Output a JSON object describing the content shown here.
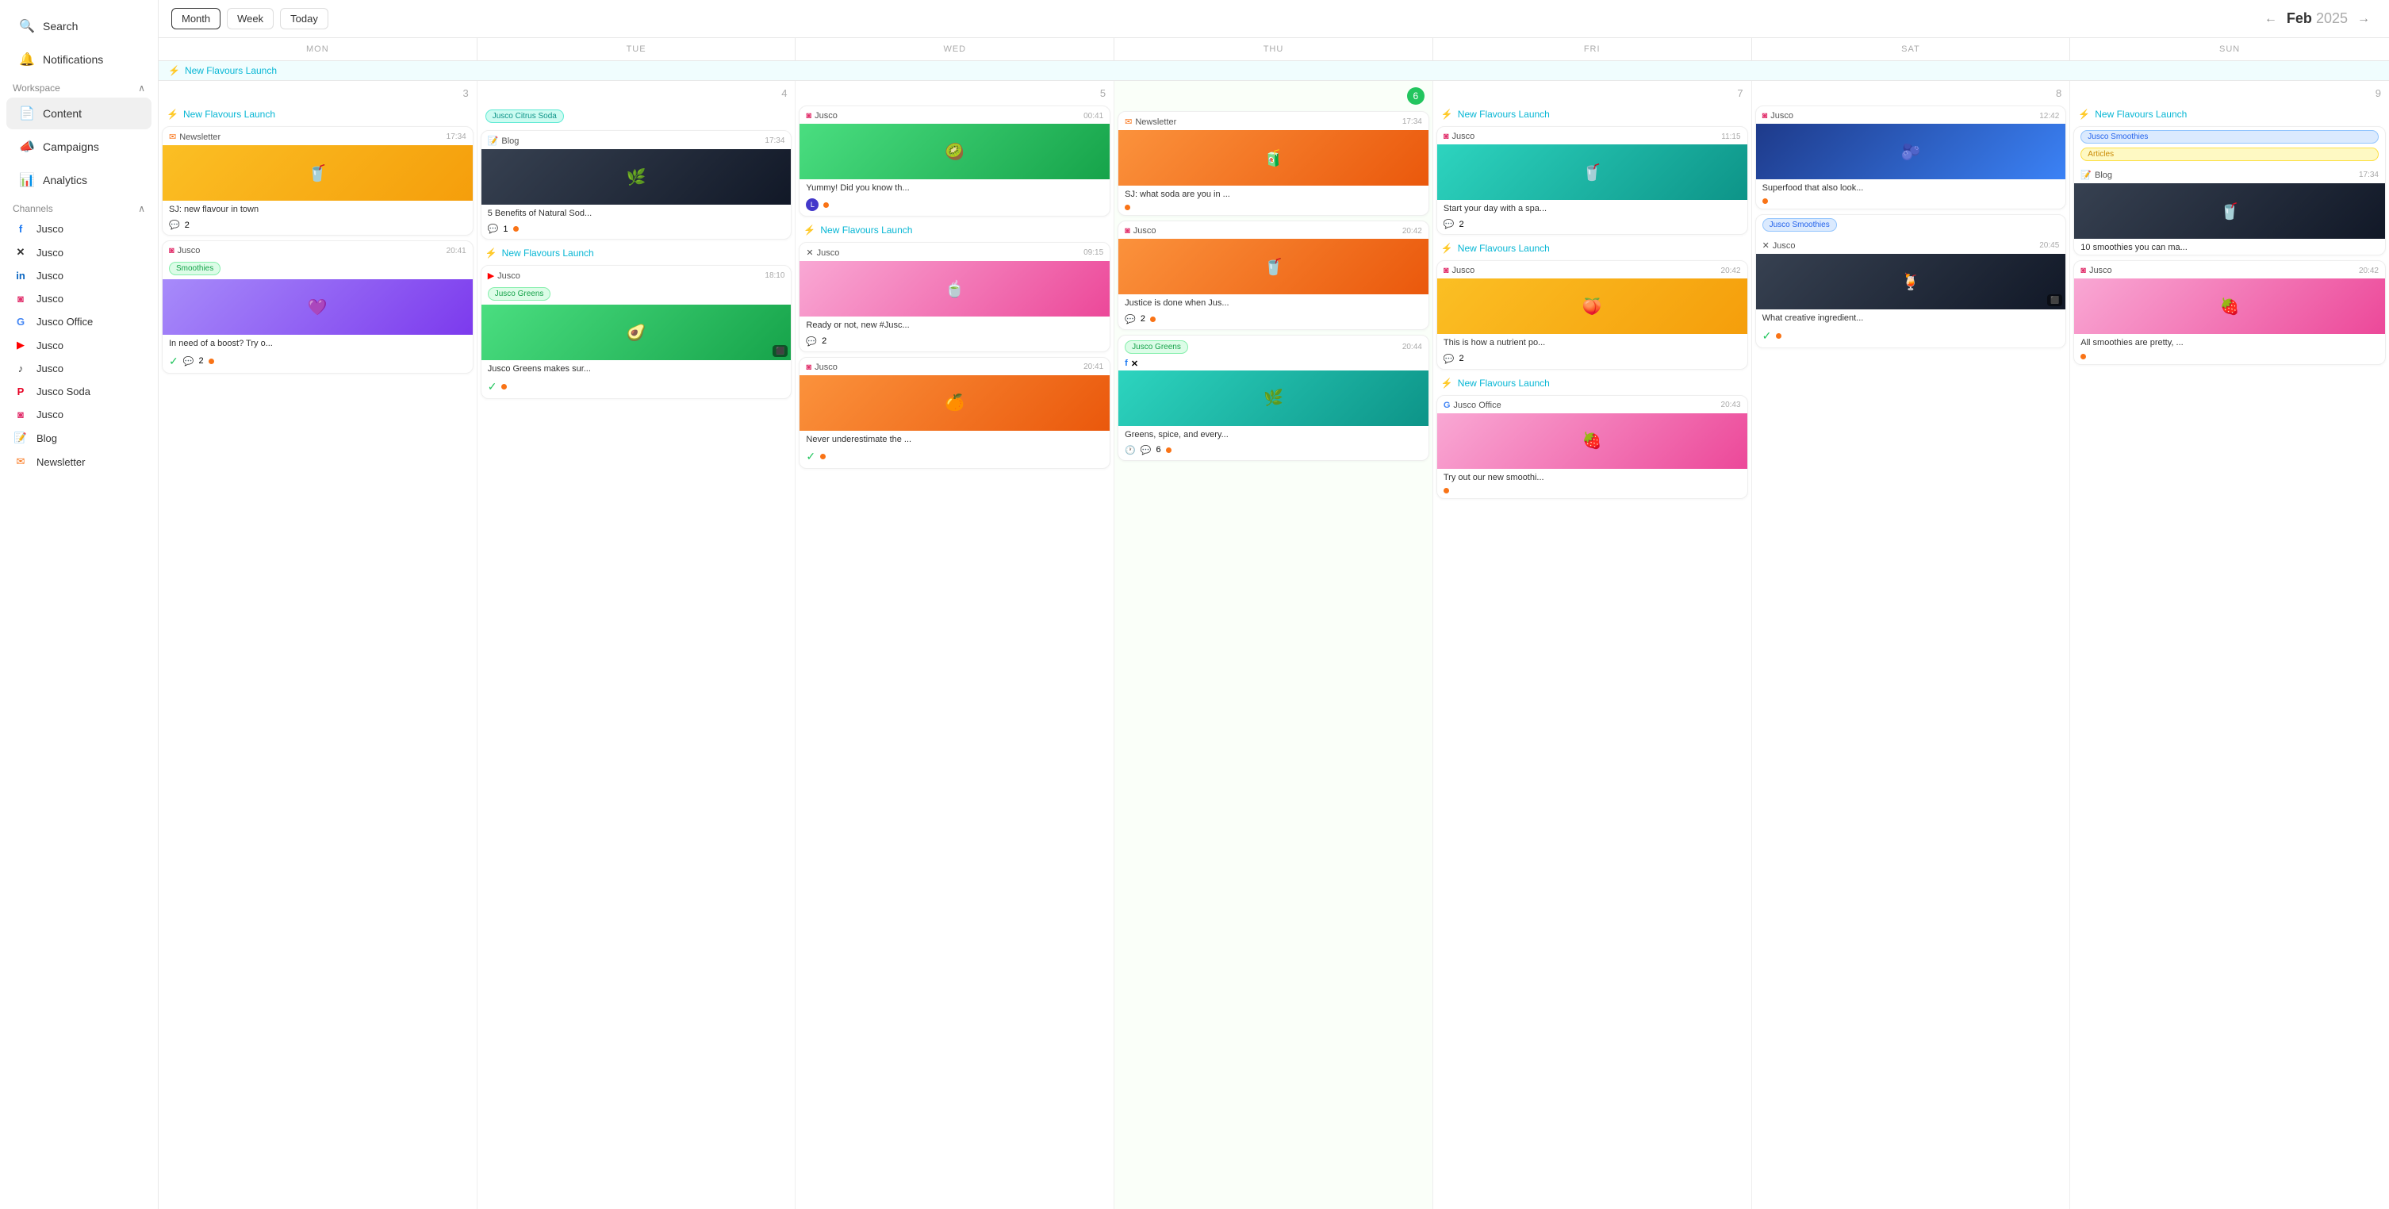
{
  "sidebar": {
    "search_label": "Search",
    "notifications_label": "Notifications",
    "workspace_label": "Workspace",
    "workspace_expanded": true,
    "nav_items": [
      {
        "id": "content",
        "label": "Content",
        "icon": "📄",
        "active": true
      },
      {
        "id": "campaigns",
        "label": "Campaigns",
        "icon": "📣"
      },
      {
        "id": "analytics",
        "label": "Analytics",
        "icon": "📊"
      }
    ],
    "channels_label": "Channels",
    "channels_expanded": true,
    "channels": [
      {
        "id": "facebook",
        "label": "Jusco",
        "icon": "fb",
        "color": "#1877f2"
      },
      {
        "id": "twitter",
        "label": "Jusco",
        "icon": "x",
        "color": "#000"
      },
      {
        "id": "linkedin",
        "label": "Jusco",
        "icon": "in",
        "color": "#0a66c2"
      },
      {
        "id": "instagram",
        "label": "Jusco",
        "icon": "ig",
        "color": "#e1306c"
      },
      {
        "id": "google",
        "label": "Jusco Office",
        "icon": "g",
        "color": "#4285f4"
      },
      {
        "id": "youtube",
        "label": "Jusco",
        "icon": "yt",
        "color": "#ff0000"
      },
      {
        "id": "tiktok",
        "label": "Jusco",
        "icon": "tt",
        "color": "#000"
      },
      {
        "id": "pinterest",
        "label": "Jusco Soda",
        "icon": "pi",
        "color": "#e60023"
      },
      {
        "id": "jusco2",
        "label": "Jusco",
        "icon": "ig2",
        "color": "#e1306c"
      },
      {
        "id": "blog",
        "label": "Blog",
        "icon": "bl",
        "color": "#22c55e"
      },
      {
        "id": "newsletter",
        "label": "Newsletter",
        "icon": "nl",
        "color": "#f97316"
      }
    ]
  },
  "calendar": {
    "view_month_label": "Month",
    "view_week_label": "Week",
    "view_today_label": "Today",
    "current_month": "Feb",
    "current_year": "2025",
    "prev_arrow": "←",
    "next_arrow": "→",
    "day_labels": [
      "MON",
      "TUE",
      "WED",
      "THU",
      "FRI",
      "SAT",
      "SUN"
    ],
    "day_numbers": [
      "3",
      "4",
      "5",
      "6",
      "7",
      "8",
      "9"
    ],
    "campaign_label": "New Flavours Launch",
    "columns": [
      {
        "day": "3",
        "events": [
          {
            "type": "campaign",
            "label": "New Flavours Launch"
          },
          {
            "type": "post",
            "channel": "Newsletter",
            "channel_icon": "newsletter",
            "time": "17:34",
            "image_class": "img-yellow",
            "image_emoji": "🥤",
            "text": "SJ: new flavour in town",
            "comments": "2",
            "status_dot": null
          },
          {
            "type": "post",
            "channel": "Jusco",
            "channel_icon": "instagram",
            "time": "20:41",
            "tag": "Smoothies",
            "tag_class": "tag-green",
            "image_class": "img-purple",
            "image_emoji": "💜",
            "text": "In need of a boost? Try o...",
            "check": true,
            "comments": "2",
            "status_dot": "orange"
          }
        ]
      },
      {
        "day": "4",
        "events": [
          {
            "type": "tag-post",
            "tag": "Jusco Citrus Soda",
            "tag_class": "tag-teal"
          },
          {
            "type": "post",
            "channel": "Blog",
            "channel_icon": "blog",
            "time": "17:34",
            "image_class": "img-dark",
            "image_emoji": "🌿",
            "text": "5 Benefits of Natural Sod...",
            "comments": "1",
            "status_dot": "orange"
          },
          {
            "type": "campaign",
            "label": "New Flavours Launch"
          },
          {
            "type": "post-with-tag",
            "channel": "Jusco",
            "channel_icon": "youtube",
            "time": "18:10",
            "tag": "Jusco Greens",
            "tag_class": "tag-green",
            "image_class": "img-green",
            "image_emoji": "🥑",
            "text": "Jusco Greens makes sur...",
            "check": true,
            "status_dot": "orange",
            "has_video": true
          }
        ]
      },
      {
        "day": "5",
        "events": [
          {
            "type": "post",
            "channel": "Jusco",
            "channel_icon": "instagram",
            "time": "00:41",
            "image_class": "img-green",
            "image_emoji": "🥝",
            "text": "Yummy! Did you know th...",
            "status_dot": "orange"
          },
          {
            "type": "campaign",
            "label": "New Flavours Launch"
          },
          {
            "type": "post",
            "channel": "Jusco",
            "channel_icon": "twitter",
            "time": "09:15",
            "image_class": "img-pink",
            "image_emoji": "🍵",
            "text": "Ready or not, new #Jusc...",
            "comments": "2"
          },
          {
            "type": "post",
            "channel": "Jusco",
            "channel_icon": "instagram",
            "time": "20:41",
            "image_class": "img-orange",
            "image_emoji": "🍊",
            "text": "Never underestimate the ...",
            "check": true,
            "status_dot": "orange"
          }
        ]
      },
      {
        "day": "6",
        "events": [
          {
            "type": "post",
            "channel": "Newsletter",
            "channel_icon": "newsletter",
            "time": "17:34",
            "image_class": "img-orange",
            "image_emoji": "🧃",
            "text": "SJ: what soda are you in ...",
            "status_dot": "orange"
          },
          {
            "type": "post",
            "channel": "Jusco",
            "channel_icon": "instagram",
            "time": "20:42",
            "image_class": "img-orange",
            "image_emoji": "🥤",
            "text": "Justice is done when Jus...",
            "comments": "2",
            "status_dot": "orange"
          },
          {
            "type": "post-with-tag",
            "tag": "Jusco Greens",
            "tag_class": "tag-green",
            "channel_icons": [
              "facebook",
              "twitter"
            ],
            "time": "20:44",
            "image_class": "img-teal",
            "image_emoji": "🌿",
            "text": "Greens, spice, and every...",
            "clock_icon": true,
            "comments": "6",
            "status_dot": "orange"
          }
        ]
      },
      {
        "day": "7",
        "events": [
          {
            "type": "campaign",
            "label": "New Flavours Launch"
          },
          {
            "type": "post",
            "channel": "Jusco",
            "channel_icon": "instagram",
            "time": "11:15",
            "image_class": "img-teal",
            "image_emoji": "🥤",
            "text": "Start your day with a spa...",
            "comments": "2"
          },
          {
            "type": "campaign",
            "label": "New Flavours Launch"
          },
          {
            "type": "post",
            "channel": "Jusco",
            "channel_icon": "instagram",
            "time": "20:42",
            "image_class": "img-yellow",
            "image_emoji": "🍑",
            "text": "This is how a nutrient po...",
            "comments": "2"
          },
          {
            "type": "campaign",
            "label": "New Flavours Launch"
          },
          {
            "type": "post",
            "channel": "Jusco Office",
            "channel_icon": "google",
            "time": "20:43",
            "image_class": "img-pink",
            "image_emoji": "🍓",
            "text": "Try out our new smoothi...",
            "status_dot": "orange"
          }
        ]
      },
      {
        "day": "8",
        "events": [
          {
            "type": "post",
            "channel": "Jusco",
            "channel_icon": "instagram",
            "time": "12:42",
            "image_class": "img-blueberry",
            "image_emoji": "🫐",
            "text": "Superfood that also look...",
            "status_dot": "orange"
          },
          {
            "type": "post-with-tag",
            "tag": "Jusco Smoothies",
            "tag_class": "tag-blue",
            "channel": "Jusco",
            "channel_icon": "twitter",
            "time": "20:45",
            "has_video": true,
            "image_class": "img-dark",
            "image_emoji": "🍹",
            "text": "What creative ingredient...",
            "check": true,
            "status_dot": "orange"
          }
        ]
      },
      {
        "day": "9",
        "events": [
          {
            "type": "campaign",
            "label": "New Flavours Launch"
          },
          {
            "type": "post-with-tags",
            "tags": [
              "Jusco Smoothies",
              "Articles"
            ],
            "tag_classes": [
              "tag-blue",
              "tag-yellow"
            ],
            "channel": "Blog",
            "channel_icon": "blog",
            "time": "17:34",
            "image_class": "img-dark",
            "image_emoji": "🥤",
            "text": "10 smoothies you can ma...",
            "status_dot": null
          },
          {
            "type": "post",
            "channel": "Jusco",
            "channel_icon": "instagram",
            "time": "20:42",
            "image_class": "img-pink",
            "image_emoji": "🍓",
            "text": "All smoothies are pretty, ...",
            "status_dot": "orange"
          }
        ]
      }
    ]
  }
}
